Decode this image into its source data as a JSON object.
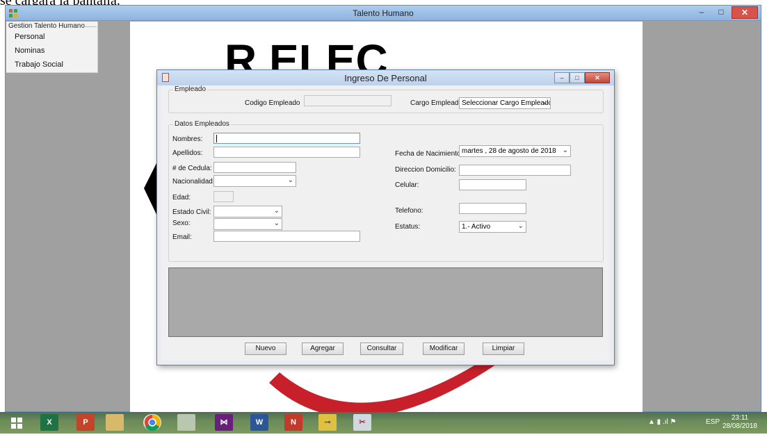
{
  "caption": "se cargara la pantalla.",
  "main_window": {
    "title": "Talento Humano",
    "minimize": "–",
    "maximize": "□",
    "close": "✕"
  },
  "menu": {
    "group": "Gestion Talento Humano",
    "items": [
      "Personal",
      "Nominas",
      "Trabajo Social"
    ]
  },
  "background_logo_text": "R ELEC",
  "dialog": {
    "title": "Ingreso De Personal",
    "minimize": "–",
    "maximize": "□",
    "close": "✕",
    "empleado_group": "Empleado",
    "codigo_label": "Codigo Empleado",
    "codigo_value": "",
    "cargo_label": "Cargo Empleado",
    "cargo_value": "Seleccionar Cargo Empleado",
    "datos_group": "Datos Empleados",
    "fields": {
      "nombres": "Nombres:",
      "apellidos": "Apellidos:",
      "cedula": "# de Cedula:",
      "nacionalidad": "Nacionalidad:",
      "edad": "Edad:",
      "estado_civil": "Estado Civil:",
      "sexo": "Sexo:",
      "email": "Email:",
      "fecha_nacimiento": "Fecha de Nacimiento:",
      "direccion": "Direccion Domicilio:",
      "celular": "Celular:",
      "telefono": "Telefono:",
      "estatus": "Estatus:"
    },
    "fecha_value": "martes  , 28 de   agosto   de 2018",
    "estatus_value": "1.- Activo",
    "buttons": [
      "Nuevo",
      "Agregar",
      "Consultar",
      "Modificar",
      "Limpiar"
    ]
  },
  "taskbar": {
    "apps": [
      "X",
      "P",
      "W",
      "N"
    ],
    "tray_lang": "ESP",
    "time": "23:11",
    "date": "28/08/2018"
  }
}
